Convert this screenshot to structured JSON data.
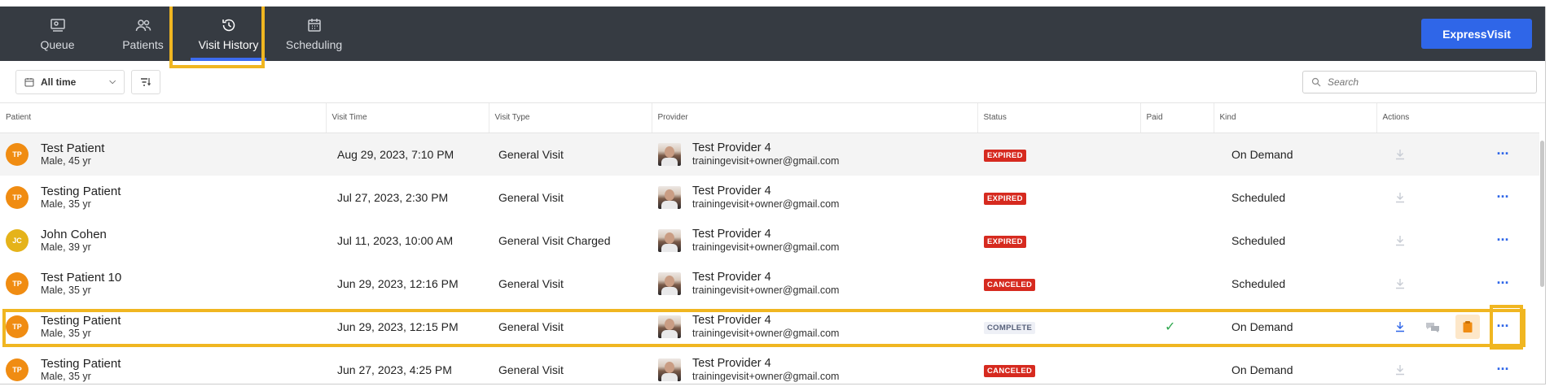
{
  "nav": {
    "tabs": [
      {
        "label": "Queue",
        "icon": "queue-icon"
      },
      {
        "label": "Patients",
        "icon": "patients-icon"
      },
      {
        "label": "Visit History",
        "icon": "history-icon",
        "active": true
      },
      {
        "label": "Scheduling",
        "icon": "calendar-icon"
      }
    ],
    "express_label": "ExpressVisit"
  },
  "toolbar": {
    "range_label": "All time",
    "search_placeholder": "Search"
  },
  "table": {
    "headers": {
      "patient": "Patient",
      "visit_time": "Visit Time",
      "visit_type": "Visit Type",
      "provider": "Provider",
      "status": "Status",
      "paid": "Paid",
      "kind": "Kind",
      "actions": "Actions"
    },
    "rows": [
      {
        "initials": "TP",
        "name": "Test Patient",
        "sub": "Male, 45 yr",
        "time": "Aug 29, 2023, 7:10 PM",
        "type": "General Visit",
        "provider": "Test Provider 4",
        "email": "trainingevisit+owner@gmail.com",
        "status": "EXPIRED",
        "paid": "",
        "kind": "On Demand"
      },
      {
        "initials": "TP",
        "name": "Testing Patient",
        "sub": "Male, 35 yr",
        "time": "Jul 27, 2023, 2:30 PM",
        "type": "General Visit",
        "provider": "Test Provider 4",
        "email": "trainingevisit+owner@gmail.com",
        "status": "EXPIRED",
        "paid": "",
        "kind": "Scheduled"
      },
      {
        "initials": "JC",
        "name": "John Cohen",
        "sub": "Male, 39 yr",
        "time": "Jul 11, 2023, 10:00 AM",
        "type": "General Visit Charged",
        "provider": "Test Provider 4",
        "email": "trainingevisit+owner@gmail.com",
        "status": "EXPIRED",
        "paid": "",
        "kind": "Scheduled"
      },
      {
        "initials": "TP",
        "name": "Test Patient 10",
        "sub": "Male, 35 yr",
        "time": "Jun 29, 2023, 12:16 PM",
        "type": "General Visit",
        "provider": "Test Provider 4",
        "email": "trainingevisit+owner@gmail.com",
        "status": "CANCELED",
        "paid": "",
        "kind": "Scheduled"
      },
      {
        "initials": "TP",
        "name": "Testing Patient",
        "sub": "Male, 35 yr",
        "time": "Jun 29, 2023, 12:15 PM",
        "type": "General Visit",
        "provider": "Test Provider 4",
        "email": "trainingevisit+owner@gmail.com",
        "status": "COMPLETE",
        "paid": "✓",
        "kind": "On Demand"
      },
      {
        "initials": "TP",
        "name": "Testing Patient",
        "sub": "Male, 35 yr",
        "time": "Jun 27, 2023, 4:25 PM",
        "type": "General Visit",
        "provider": "Test Provider 4",
        "email": "trainingevisit+owner@gmail.com",
        "status": "CANCELED",
        "paid": "",
        "kind": "On Demand"
      }
    ],
    "more_label": "···"
  },
  "colors": {
    "topbar": "#363b42",
    "accent": "#2f66e8",
    "highlight": "#f0b621",
    "badge_red": "#d62a1f",
    "avatar_orange": "#f08c12",
    "paid_check": "#2fa84f"
  }
}
